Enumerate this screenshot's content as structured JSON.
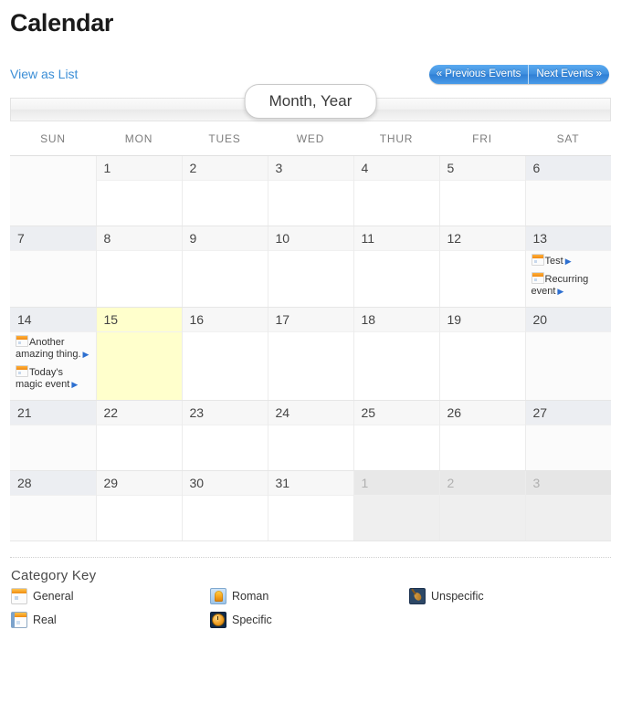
{
  "page": {
    "title": "Calendar"
  },
  "toolbar": {
    "view_as_list": "View as List",
    "previous_events": "« Previous Events",
    "next_events": "Next Events »",
    "month_label": "Month, Year"
  },
  "calendar": {
    "weekday_headers": [
      "SUN",
      "MON",
      "TUES",
      "WED",
      "THUR",
      "FRI",
      "SAT"
    ],
    "today_highlight_color": "#ffffcc",
    "link_color": "#3b8ed6",
    "weeks": [
      {
        "cells": [
          {
            "day": "",
            "blank": true,
            "weekend": true,
            "events": []
          },
          {
            "day": "1",
            "events": []
          },
          {
            "day": "2",
            "events": []
          },
          {
            "day": "3",
            "events": []
          },
          {
            "day": "4",
            "events": []
          },
          {
            "day": "5",
            "events": []
          },
          {
            "day": "6",
            "weekend": true,
            "events": []
          }
        ]
      },
      {
        "cells": [
          {
            "day": "7",
            "weekend": true,
            "events": []
          },
          {
            "day": "8",
            "events": []
          },
          {
            "day": "9",
            "events": []
          },
          {
            "day": "10",
            "events": []
          },
          {
            "day": "11",
            "events": []
          },
          {
            "day": "12",
            "events": []
          },
          {
            "day": "13",
            "weekend": true,
            "events": [
              {
                "title": "Test",
                "icon": "calendar-event-icon",
                "arrow": "▶"
              },
              {
                "title": "Recurring event",
                "icon": "calendar-event-icon",
                "arrow": "▶"
              }
            ]
          }
        ]
      },
      {
        "cells": [
          {
            "day": "14",
            "weekend": true,
            "events": [
              {
                "title": "Another amazing thing.",
                "icon": "calendar-event-icon",
                "arrow": "▶"
              },
              {
                "title": "Today's magic event",
                "icon": "calendar-event-icon",
                "arrow": "▶"
              }
            ]
          },
          {
            "day": "15",
            "today": true,
            "events": []
          },
          {
            "day": "16",
            "events": []
          },
          {
            "day": "17",
            "events": []
          },
          {
            "day": "18",
            "events": []
          },
          {
            "day": "19",
            "events": []
          },
          {
            "day": "20",
            "weekend": true,
            "events": []
          }
        ]
      },
      {
        "cells": [
          {
            "day": "21",
            "weekend": true,
            "events": []
          },
          {
            "day": "22",
            "events": []
          },
          {
            "day": "23",
            "events": []
          },
          {
            "day": "24",
            "events": []
          },
          {
            "day": "25",
            "events": []
          },
          {
            "day": "26",
            "events": []
          },
          {
            "day": "27",
            "weekend": true,
            "events": []
          }
        ]
      },
      {
        "cells": [
          {
            "day": "28",
            "weekend": true,
            "events": []
          },
          {
            "day": "29",
            "events": []
          },
          {
            "day": "30",
            "events": []
          },
          {
            "day": "31",
            "events": []
          },
          {
            "day": "1",
            "other_month": true,
            "events": []
          },
          {
            "day": "2",
            "other_month": true,
            "events": []
          },
          {
            "day": "3",
            "other_month": true,
            "weekend": true,
            "events": []
          }
        ]
      }
    ]
  },
  "category_key": {
    "title": "Category Key",
    "items": [
      {
        "label": "General",
        "icon": "calendar-category-icon",
        "style": "general"
      },
      {
        "label": "Roman",
        "icon": "helmet-category-icon",
        "style": "roman"
      },
      {
        "label": "Unspecific",
        "icon": "guitar-category-icon",
        "style": "unspecific"
      },
      {
        "label": "Real",
        "icon": "notebook-category-icon",
        "style": "real"
      },
      {
        "label": "Specific",
        "icon": "clock-category-icon",
        "style": "specific"
      }
    ]
  }
}
